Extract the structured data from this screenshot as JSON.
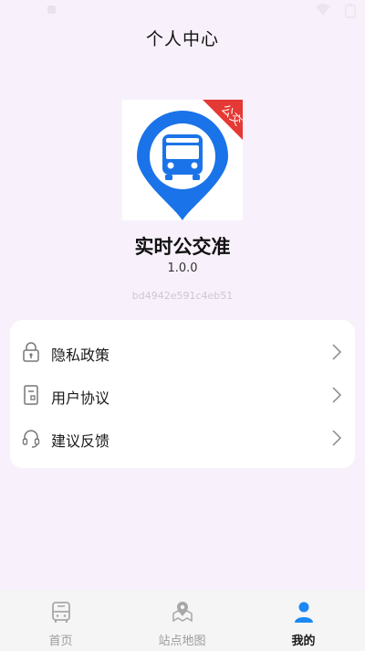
{
  "header": {
    "title": "个人中心"
  },
  "app": {
    "logo_badge": "公交",
    "name": "实时公交准",
    "version": "1.0.0",
    "build_hash": "bd4942e591c4eb51"
  },
  "menu": {
    "items": [
      {
        "label": "隐私政策",
        "icon": "lock-icon"
      },
      {
        "label": "用户协议",
        "icon": "document-icon"
      },
      {
        "label": "建议反馈",
        "icon": "headset-icon"
      }
    ]
  },
  "bottom_nav": {
    "tabs": [
      {
        "label": "首页",
        "icon": "bus-icon",
        "active": false
      },
      {
        "label": "站点地图",
        "icon": "map-pin-icon",
        "active": false
      },
      {
        "label": "我的",
        "icon": "person-icon",
        "active": true
      }
    ]
  },
  "colors": {
    "brand_blue": "#1a73e8",
    "badge_red": "#e53935",
    "active_tab": "#1a88f5",
    "background": "#f8f1fb"
  }
}
